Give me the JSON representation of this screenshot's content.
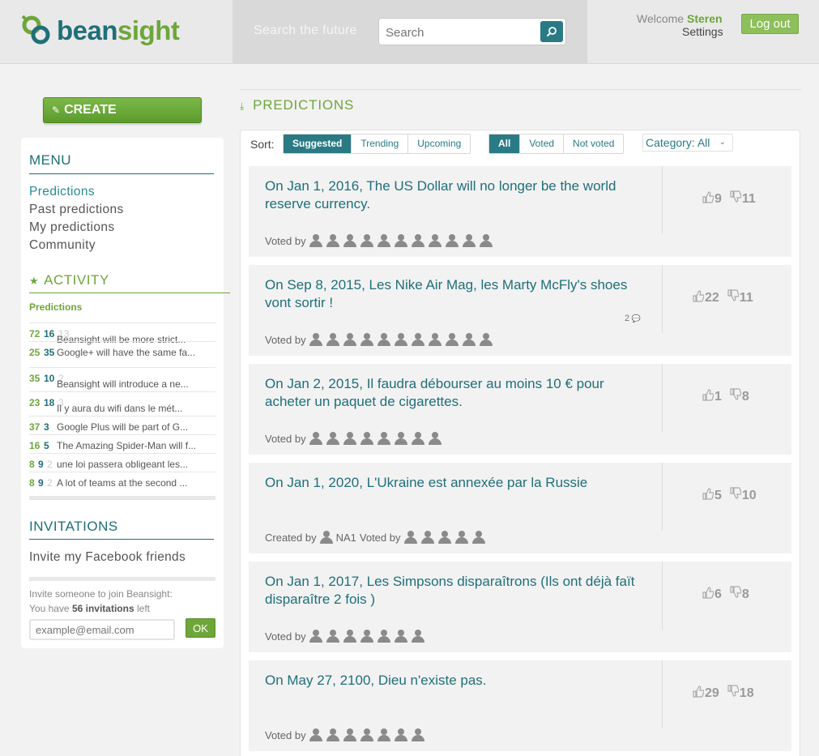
{
  "header": {
    "logo_text_primary": "bean",
    "logo_text_accent": "sight",
    "search_tagline": "Search the future",
    "search_placeholder": "Search",
    "welcome_prefix": "Welcome",
    "username": "Steren",
    "settings_label": "Settings",
    "logout_label": "Log out"
  },
  "sidebar": {
    "create_label": "CREATE",
    "menu_title": "MENU",
    "menu_items": [
      "Predictions",
      "Past predictions",
      "My predictions",
      "Community"
    ],
    "activity_title": "ACTIVITY",
    "activity_subtitle": "Predictions",
    "activity": [
      {
        "up": "72",
        "down": "16",
        "count": "13",
        "text": "Beansight will be more strict..."
      },
      {
        "up": "25",
        "down": "35",
        "count": "",
        "text": "Google+ will have the same fa..."
      },
      {
        "up": "35",
        "down": "10",
        "count": "2",
        "text": "Beansight will introduce a ne..."
      },
      {
        "up": "23",
        "down": "18",
        "count": "3",
        "text": "Il y aura du wifi dans le mét..."
      },
      {
        "up": "37",
        "down": "3",
        "count": "",
        "text": "Google Plus will be part of G..."
      },
      {
        "up": "16",
        "down": "5",
        "count": "",
        "text": "The Amazing Spider-Man will f..."
      },
      {
        "up": "8",
        "down": "9",
        "count": "2",
        "text": "une loi passera obligeant les..."
      },
      {
        "up": "8",
        "down": "9",
        "count": "2",
        "text": "A lot of teams at the second ..."
      }
    ],
    "invitations_title": "INVITATIONS",
    "invite_facebook": "Invite my Facebook friends",
    "invite_text_1": "Invite someone to join Beansight:",
    "invite_text_2_prefix": "You have",
    "invite_count": "56 invitations",
    "invite_text_2_suffix": "left",
    "invite_placeholder": "example@email.com",
    "invite_ok": "OK"
  },
  "main": {
    "section_title": "PREDICTIONS",
    "sort_label": "Sort:",
    "sort_options": [
      "Suggested",
      "Trending",
      "Upcoming"
    ],
    "sort_selected": "Suggested",
    "filter_options": [
      "All",
      "Voted",
      "Not voted"
    ],
    "filter_selected": "All",
    "category_label": "Category: All",
    "predictions": [
      {
        "title": "On Jan 1, 2016, The US Dollar will no longer be the world reserve currency.",
        "voted_by_label": "Voted by",
        "voters": 11,
        "created_by_label": "",
        "creator": "",
        "comments": "",
        "up": "9",
        "down": "11"
      },
      {
        "title": "On Sep 8, 2015, Les Nike Air Mag, les Marty McFly's shoes vont sortir !",
        "voted_by_label": "Voted by",
        "voters": 11,
        "created_by_label": "",
        "creator": "",
        "comments": "2",
        "up": "22",
        "down": "11"
      },
      {
        "title": "On Jan 2, 2015, Il faudra débourser au moins 10 € pour acheter un paquet de cigarettes.",
        "voted_by_label": "Voted by",
        "voters": 8,
        "created_by_label": "",
        "creator": "",
        "comments": "",
        "up": "1",
        "down": "8"
      },
      {
        "title": "On Jan 1, 2020, L'Ukraine est annexée par la Russie",
        "voted_by_label": "Voted by",
        "voters": 5,
        "created_by_label": "Created by",
        "creator": "NA1",
        "comments": "",
        "up": "5",
        "down": "10"
      },
      {
        "title": "On Jan 1, 2017, Les Simpsons disparaîtrons (Ils ont déjà faït disparaître 2 fois )",
        "voted_by_label": "Voted by",
        "voters": 7,
        "created_by_label": "",
        "creator": "",
        "comments": "",
        "up": "6",
        "down": "8"
      },
      {
        "title": "On May 27, 2100, Dieu n'existe pas.",
        "voted_by_label": "Voted by",
        "voters": 7,
        "created_by_label": "",
        "creator": "",
        "comments": "",
        "up": "29",
        "down": "18"
      }
    ]
  },
  "colors": {
    "brand_teal": "#1f6f79",
    "brand_green": "#6ea63a",
    "button_teal": "#2a7a85"
  },
  "icons": {
    "search": "magnifier-icon",
    "pencil": "pencil-icon",
    "star": "star-icon",
    "thumbs_up": "thumbs-up-icon",
    "thumbs_down": "thumbs-down-icon",
    "comment": "comment-bubble-icon",
    "user": "user-silhouette-icon"
  }
}
